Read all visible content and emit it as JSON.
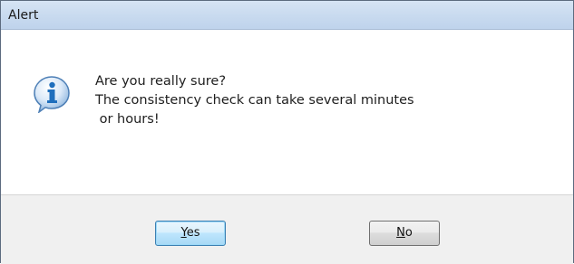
{
  "window": {
    "title": "Alert"
  },
  "message": {
    "icon": "info-icon",
    "lines": [
      "Are you really sure?",
      "The consistency check can take several minutes",
      " or hours!"
    ]
  },
  "buttons": {
    "yes": {
      "mnemonic": "Y",
      "rest": "es",
      "default": true
    },
    "no": {
      "mnemonic": "N",
      "rest": "o",
      "default": false
    }
  },
  "colors": {
    "titlebar": "#c8daef",
    "button_bar": "#f0f0f0",
    "icon_fill": "#1f6fbd"
  }
}
